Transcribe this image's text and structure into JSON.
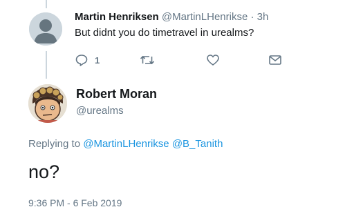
{
  "parent_tweet": {
    "name": "Martin Henriksen",
    "handle": "@MartinLHenrikse",
    "separator": "·",
    "time": "3h",
    "text": "But didnt you do timetravel in urealms?",
    "reply_count": "1",
    "icons": [
      "reply-icon",
      "retweet-icon",
      "like-icon",
      "message-icon"
    ]
  },
  "main_tweet": {
    "name": "Robert Moran",
    "handle": "@urealms",
    "replying_prefix": "Replying to",
    "mentions": [
      "@MartinLHenrikse",
      "@B_Tanith"
    ],
    "text": "no?",
    "timestamp": "9:36 PM - 6 Feb 2019"
  },
  "colors": {
    "link": "#1b95e0",
    "secondary_text": "#657786",
    "thread_line": "#ccd6dd"
  }
}
